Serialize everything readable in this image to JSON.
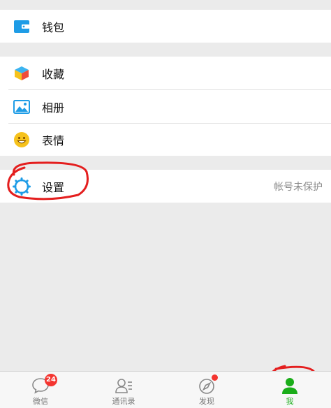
{
  "groups": {
    "wallet": {
      "label": "钱包"
    },
    "favorites": {
      "label": "收藏"
    },
    "album": {
      "label": "相册"
    },
    "stickers": {
      "label": "表情"
    },
    "settings": {
      "label": "设置",
      "status": "帐号未保护"
    }
  },
  "tabbar": {
    "chats": {
      "label": "微信",
      "badge": "24",
      "icon": "chat-bubble-icon"
    },
    "contacts": {
      "label": "通讯录",
      "icon": "contacts-icon"
    },
    "discover": {
      "label": "发现",
      "icon": "compass-icon"
    },
    "me": {
      "label": "我",
      "icon": "person-icon"
    }
  },
  "colors": {
    "accent": "#1aad19",
    "badge": "#f43530",
    "wallet_icon": "#1e9ce6",
    "annotation": "#e41e1e"
  }
}
